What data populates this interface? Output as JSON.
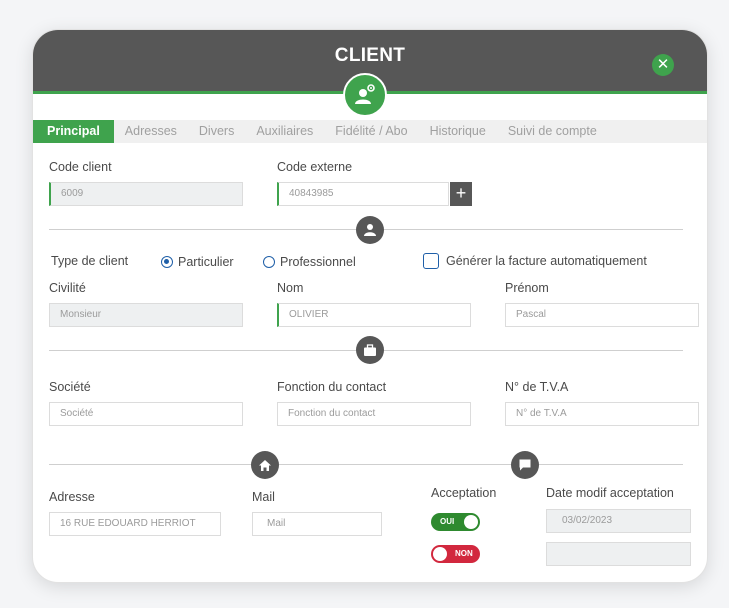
{
  "header": {
    "title": "CLIENT",
    "close_icon": "close-icon",
    "avatar_icon": "user-gear-icon"
  },
  "tabs": [
    {
      "label": "Principal",
      "active": true
    },
    {
      "label": "Adresses"
    },
    {
      "label": "Divers"
    },
    {
      "label": "Auxiliaires"
    },
    {
      "label": "Fidélité / Abo"
    },
    {
      "label": "Historique"
    },
    {
      "label": "Suivi de compte"
    }
  ],
  "codes": {
    "code_client_label": "Code client",
    "code_client_value": "6009",
    "code_externe_label": "Code externe",
    "code_externe_value": "40843985",
    "add_icon": "plus-icon"
  },
  "client_type": {
    "label": "Type de client",
    "particulier": "Particulier",
    "professionnel": "Professionnel",
    "selected": "Particulier",
    "invoice_checkbox": "Générer la facture automatiquement"
  },
  "identity": {
    "civilite_label": "Civilité",
    "civilite_value": "Monsieur",
    "nom_label": "Nom",
    "nom_value": "OLIVIER",
    "prenom_label": "Prénom",
    "prenom_value": "Pascal"
  },
  "company": {
    "societe_label": "Société",
    "societe_placeholder": "Société",
    "fonction_label": "Fonction du contact",
    "fonction_placeholder": "Fonction du contact",
    "tva_label": "N° de T.V.A",
    "tva_placeholder": "N° de T.V.A"
  },
  "contact": {
    "adresse_label": "Adresse",
    "adresse_value": "16 RUE EDOUARD HERRIOT",
    "mail_label": "Mail",
    "mail_placeholder": "Mail",
    "acceptation_label": "Acceptation",
    "oui": "OUI",
    "non": "NON",
    "date_label": "Date modif acceptation",
    "date_value": "03/02/2023"
  },
  "icons": {
    "person": "person-icon",
    "briefcase": "briefcase-icon",
    "home": "home-icon",
    "chat": "chat-icon"
  },
  "colors": {
    "accent": "#3fa34d",
    "header": "#575757",
    "toggle_on": "#2e8a2f",
    "toggle_off": "#d2283e",
    "radio": "#1f5fa8"
  }
}
